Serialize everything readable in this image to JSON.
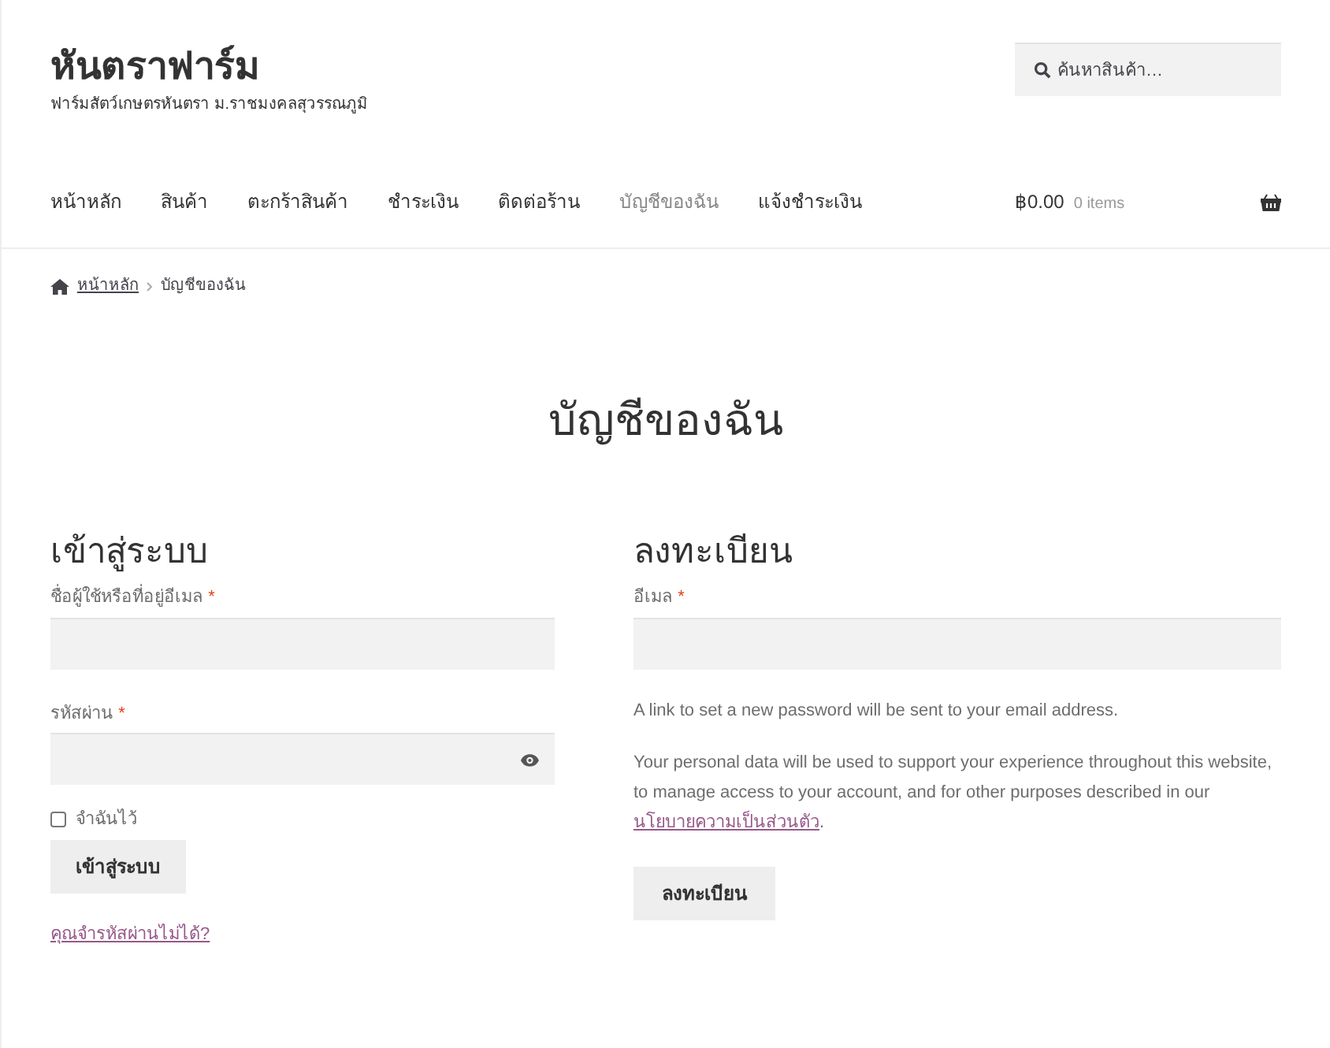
{
  "site": {
    "title": "หันตราฟาร์ม",
    "tagline": "ฟาร์มสัตว์เกษตรหันตรา ม.ราชมงคลสุวรรณภูมิ"
  },
  "search": {
    "placeholder": "ค้นหาสินค้า…"
  },
  "nav": [
    {
      "label": "หน้าหลัก",
      "selected": false
    },
    {
      "label": "สินค้า",
      "selected": false
    },
    {
      "label": "ตะกร้าสินค้า",
      "selected": false
    },
    {
      "label": "ชำระเงิน",
      "selected": false
    },
    {
      "label": "ติดต่อร้าน",
      "selected": false
    },
    {
      "label": "บัญชีของฉัน",
      "selected": true
    },
    {
      "label": "แจ้งชำระเงิน",
      "selected": false
    }
  ],
  "cart": {
    "total": "฿0.00",
    "count": "0 items"
  },
  "breadcrumb": {
    "home": "หน้าหลัก",
    "current": "บัญชีของฉัน"
  },
  "page_title": "บัญชีของฉัน",
  "login": {
    "heading": "เข้าสู่ระบบ",
    "fields": [
      {
        "label": "ชื่อผู้ใช้หรือที่อยู่อีเมล",
        "required_mark": "*",
        "kind": "text"
      },
      {
        "label": "รหัสผ่าน",
        "required_mark": "*",
        "kind": "password"
      }
    ],
    "remember": {
      "label": "จำฉันไว้",
      "checked": false
    },
    "button": "เข้าสู่ระบบ",
    "lost_password": "คุณจำรหัสผ่านไม่ได้?"
  },
  "register": {
    "heading": "ลงทะเบียน",
    "fields": [
      {
        "label": "อีเมล",
        "required_mark": "*",
        "kind": "text"
      }
    ],
    "note": "A link to set a new password will be sent to your email address.",
    "privacy": "Your personal data will be used to support your experience throughout this website, to manage access to your account, and for other purposes described in our",
    "privacy_link": "นโยบายความเป็นส่วนตัว",
    "privacy_end": ".",
    "button": "ลงทะเบียน"
  }
}
